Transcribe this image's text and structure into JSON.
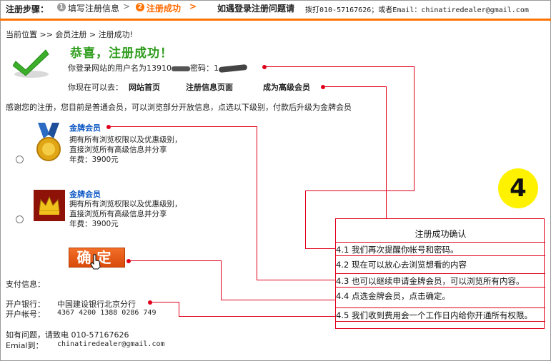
{
  "stepbar": {
    "label": "注册步骤：",
    "step1_num": "1",
    "step1": "填写注册信息",
    "arrow1": ">",
    "step2_num": "2",
    "step2": "注册成功",
    "arrow2": ">",
    "help_title": "如遇登录注册问题请",
    "help_text": "拨打010-57167626；或者Email：chinatiredealer@gmail.com"
  },
  "breadcrumb": "当前位置 >> 会员注册 > 注册成功!",
  "success": {
    "title": "恭喜，注册成功！",
    "account_prefix": "你登录网站的用户名为13910",
    "account_mid": "密码：1",
    "goto_label": "你现在可以去：",
    "links": [
      "网站首页",
      "注册信息页面",
      "成为高级会员"
    ]
  },
  "thanks": "感谢您的注册，您目前是普通会员，可以浏览部分开放信息，点选以下级别，付款后升级为金牌会员",
  "plans": [
    {
      "title": "金牌会员",
      "line1": "拥有所有浏览权限以及优惠级别，",
      "line2": "直接浏览所有高级信息并分享",
      "fee": "年费：3900元"
    },
    {
      "title": "金牌会员",
      "line1": "拥有所有浏览权限以及优惠级别，",
      "line2": "直接浏览所有高级信息并分享",
      "fee": "年费：3900元"
    }
  ],
  "confirm_label": "确定",
  "payment": {
    "title": "支付信息：",
    "bank_label": "开户银行：",
    "bank_value": "中国建设银行北京分行",
    "account_label": "开户帐号：",
    "account_value": "4367 4200 1388 0286 749"
  },
  "contact": {
    "phone_line": "如有问题，请致电 010-57167626",
    "email_label": "Emial到：",
    "email_value": "chinatiredealer@gmail.com"
  },
  "annotation": {
    "step_number": "4",
    "heading": "注册成功确认",
    "items": [
      "4.1 我们再次提醒你帐号和密码。",
      "4.2 现在可以放心去浏览想看的内容",
      "4.3 也可以继续申请金牌会员，可以浏览所有内容。",
      "4.4 点选金牌会员，点击确定。",
      "4.5 我们收到费用会一个工作日内给你开通所有权限。"
    ],
    "line_color": "#e0001b",
    "circle_color": "#fff200"
  },
  "colors": {
    "accent": "#ff7200",
    "success_green": "#2f9d1d",
    "link_blue": "#0b56c4"
  }
}
